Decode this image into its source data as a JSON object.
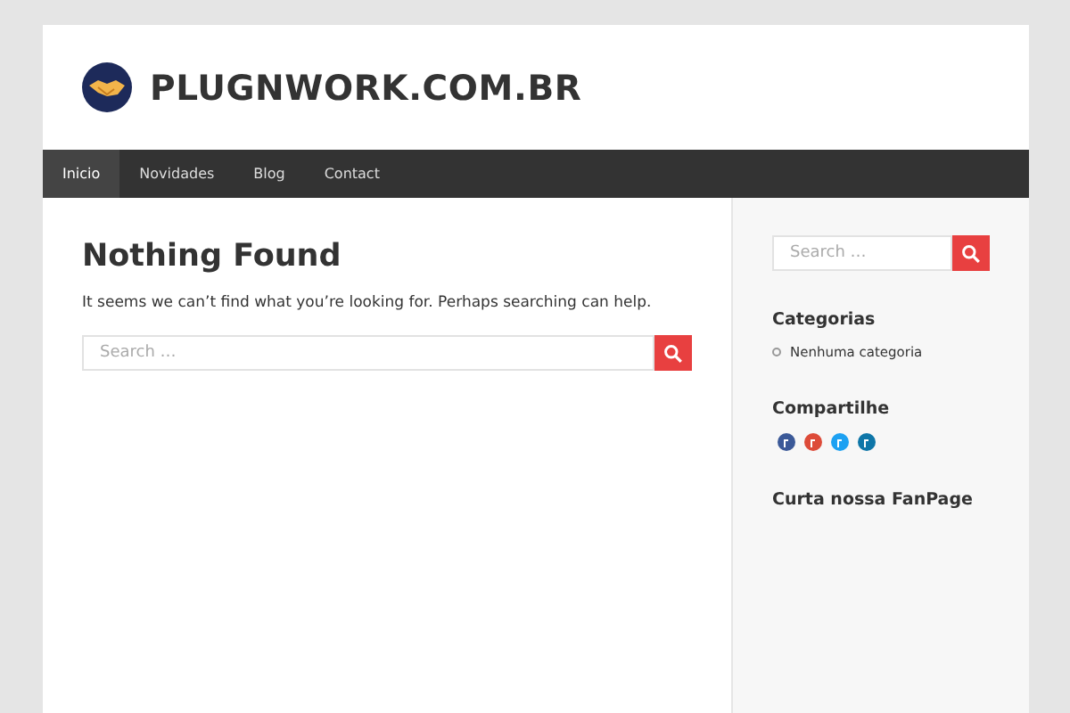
{
  "site": {
    "title": "PLUGNWORK.COM.BR"
  },
  "nav": [
    {
      "label": "Inicio",
      "selected": true
    },
    {
      "label": "Novidades",
      "selected": false
    },
    {
      "label": "Blog",
      "selected": false
    },
    {
      "label": "Contact",
      "selected": false
    }
  ],
  "main": {
    "heading": "Nothing Found",
    "message": "It seems we can’t find what you’re looking for. Perhaps searching can help.",
    "search": {
      "placeholder": "Search …"
    }
  },
  "sidebar": {
    "search": {
      "placeholder": "Search …"
    },
    "widgets": [
      {
        "kind": "list",
        "title": "Categorias",
        "items": [
          "Nenhuma categoria"
        ]
      },
      {
        "kind": "share",
        "title": "Compartilhe"
      },
      {
        "kind": "empty",
        "title": "Curta nossa FanPage"
      }
    ]
  }
}
